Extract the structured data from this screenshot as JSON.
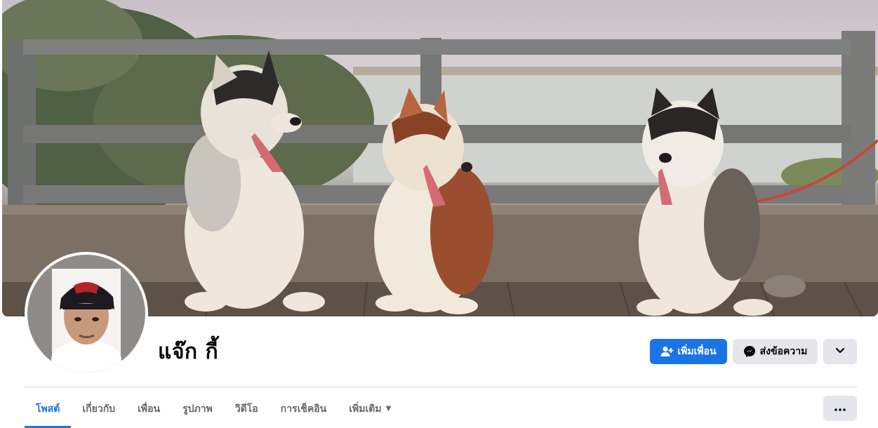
{
  "profile": {
    "name": "แจ๊ก กี้",
    "cover_alt": "three-huskies-cover-photo",
    "avatar_alt": "profile-photo"
  },
  "actions": {
    "add_friend_label": "เพิ่มเพื่อน",
    "message_label": "ส่งข้อความ",
    "add_friend_icon": "person-plus-icon",
    "message_icon": "messenger-icon",
    "expand_icon": "chevron-down-icon",
    "more_icon": "ellipsis-icon"
  },
  "tabs": [
    {
      "label": "โพสต์",
      "active": true
    },
    {
      "label": "เกี่ยวกับ",
      "active": false
    },
    {
      "label": "เพื่อน",
      "active": false
    },
    {
      "label": "รูปภาพ",
      "active": false
    },
    {
      "label": "วิดีโอ",
      "active": false
    },
    {
      "label": "การเช็คอิน",
      "active": false
    },
    {
      "label": "เพิ่มเติม",
      "active": false
    }
  ],
  "colors": {
    "accent": "#1b74e4",
    "button_gray": "#e4e6eb",
    "text_secondary": "#65676b",
    "divider": "#ced0d4"
  }
}
